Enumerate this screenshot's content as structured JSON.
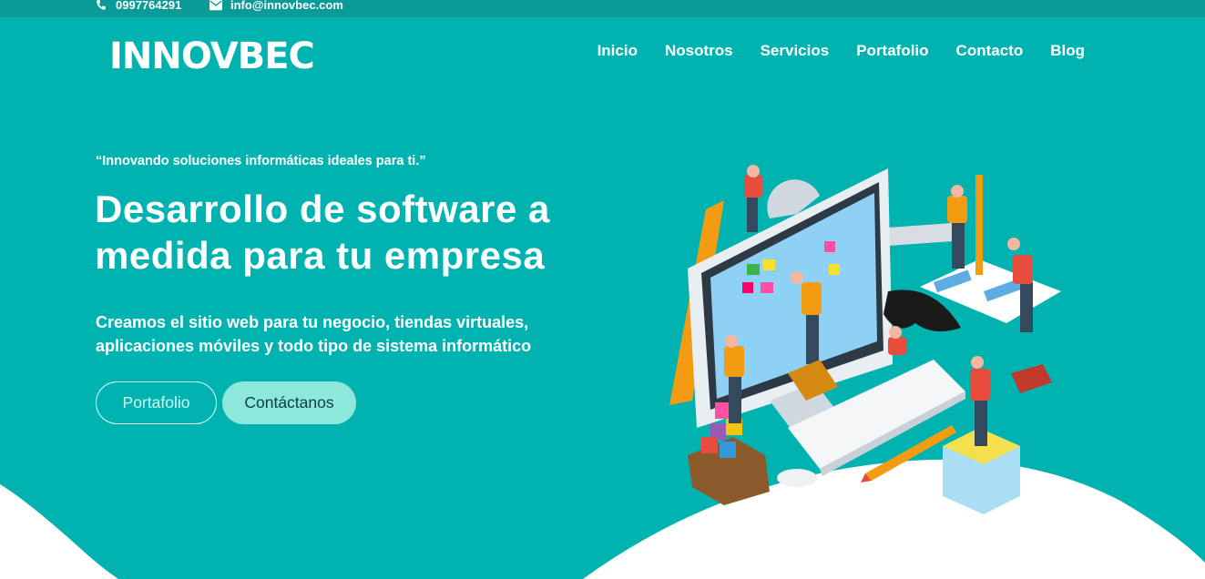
{
  "topbar": {
    "phone": "0997764291",
    "email": "info@innovbec.com",
    "phone_icon": "phone-icon",
    "email_icon": "envelope-icon"
  },
  "brand": {
    "logo_text": "INNOVBEC"
  },
  "nav": {
    "items": [
      "Inicio",
      "Nosotros",
      "Servicios",
      "Portafolio",
      "Contacto",
      "Blog"
    ]
  },
  "hero": {
    "tagline": "“Innovando soluciones informáticas ideales para ti.”",
    "headline": "Desarrollo de software a medida para tu empresa",
    "subtitle": "Creamos el sitio web para tu negocio, tiendas virtuales, aplicaciones móviles y todo tipo de sistema informático",
    "buttons": {
      "portfolio": "Portafolio",
      "contact": "Contáctanos"
    }
  },
  "colors": {
    "background": "#00b3b0",
    "topbar": "#0a9a98",
    "button_solid": "#8de8dc",
    "wave": "#ffffff"
  }
}
